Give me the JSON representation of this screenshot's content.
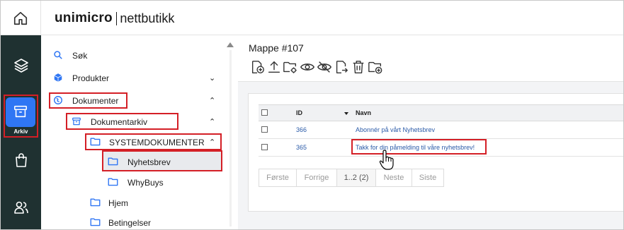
{
  "app": {
    "brand": "unimicro",
    "product": "nettbutikk"
  },
  "rail": {
    "items": [
      {
        "icon": "home-icon"
      },
      {
        "icon": "layers-icon"
      },
      {
        "icon": "archive-icon",
        "label": "Arkiv",
        "active": true
      },
      {
        "icon": "shopping-bag-icon"
      },
      {
        "icon": "users-icon"
      }
    ],
    "accent": "#2f76f4",
    "background": "#1f3131"
  },
  "tree": {
    "items": [
      {
        "label": "Søk",
        "icon": "search-icon"
      },
      {
        "label": "Produkter",
        "icon": "cube-icon",
        "chevron": "down"
      },
      {
        "label": "Dokumenter",
        "icon": "globe-icon",
        "chevron": "up"
      },
      {
        "label": "Dokumentarkiv",
        "icon": "archive-box-icon",
        "chevron": "up"
      },
      {
        "label": "SYSTEMDOKUMENTER",
        "icon": "folder-icon",
        "chevron": "up"
      },
      {
        "label": "Nyhetsbrev",
        "icon": "folder-icon",
        "selected": true
      },
      {
        "label": "WhyBuys",
        "icon": "folder-icon"
      },
      {
        "label": "Hjem",
        "icon": "folder-icon"
      },
      {
        "label": "Betingelser",
        "icon": "folder-icon"
      }
    ],
    "folder_color": "#2f76f4",
    "highlight_color": "#d41f26"
  },
  "main": {
    "title": "Mappe #107",
    "toolbar": [
      {
        "icon": "new-file-icon"
      },
      {
        "icon": "upload-icon"
      },
      {
        "icon": "folder-settings-icon"
      },
      {
        "icon": "eye-icon"
      },
      {
        "icon": "eye-off-icon"
      },
      {
        "icon": "move-file-icon"
      },
      {
        "icon": "trash-icon"
      },
      {
        "icon": "new-folder-icon"
      }
    ],
    "table": {
      "columns": {
        "id": "ID",
        "name": "Navn"
      },
      "rows": [
        {
          "id": "366",
          "name": "Abonnér på vårt Nyhetsbrev"
        },
        {
          "id": "365",
          "name": "Takk for din påmelding til våre nyhetsbrev!"
        }
      ]
    },
    "pager": {
      "first": "Første",
      "prev": "Forrige",
      "current": "1..2 (2)",
      "next": "Neste",
      "last": "Siste"
    }
  }
}
